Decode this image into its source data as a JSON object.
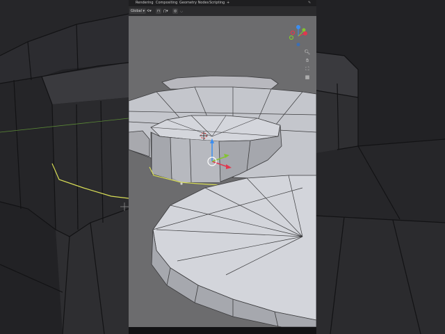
{
  "topbar": {
    "tabs": [
      "Rendering",
      "Compositing",
      "Geometry Nodes",
      "Scripting"
    ],
    "add_tab": "+"
  },
  "header": {
    "orientation": "Global",
    "pivot_icon": "pivot-icon",
    "snap_icon": "magnet-icon",
    "proportional_icon": "proportional-edit-icon"
  },
  "gizmo": {
    "axes": [
      "x",
      "y",
      "z"
    ],
    "colors": {
      "x": "#e0384f",
      "y": "#84c332",
      "z": "#3b8ef0"
    }
  },
  "nav": {
    "buttons": [
      "zoom-icon",
      "hand-icon",
      "camera-icon",
      "grid-icon"
    ]
  },
  "colors": {
    "viewport_bg": "#6d6d6f",
    "dark_bg": "#1b1b1d",
    "edge_select": "#d8dd56"
  }
}
